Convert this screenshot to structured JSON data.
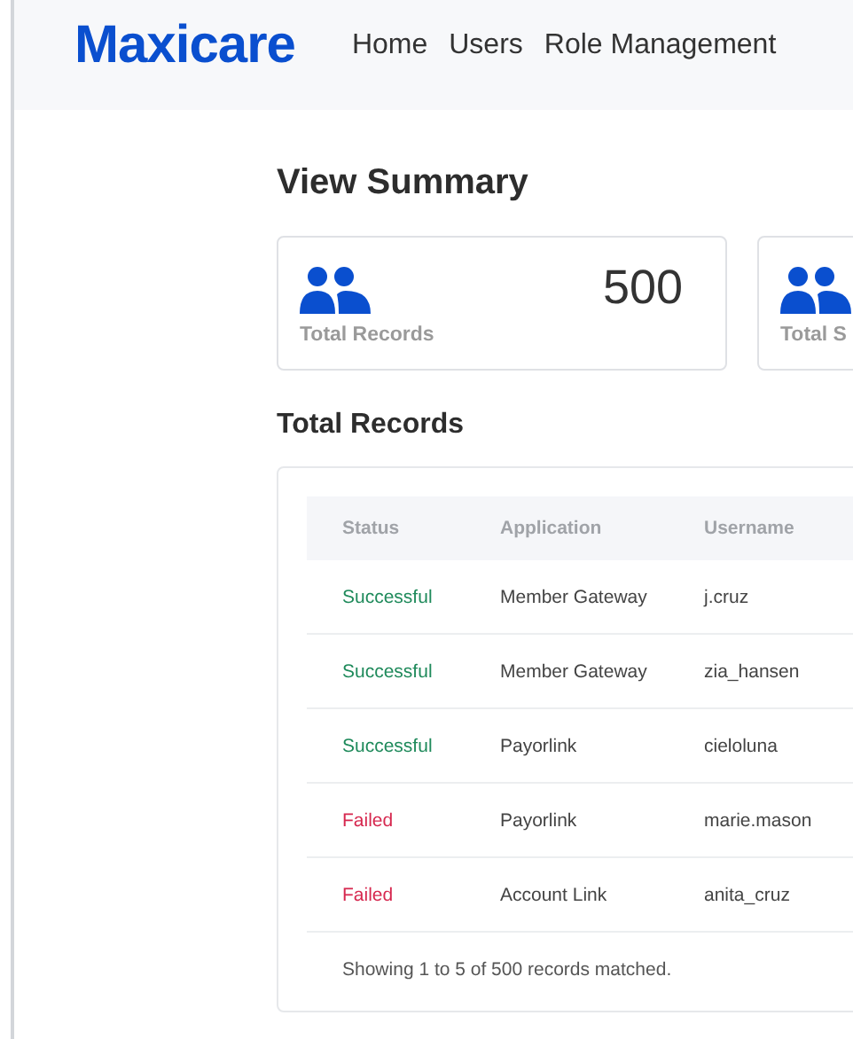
{
  "header": {
    "logo": "Maxicare",
    "nav": [
      {
        "label": "Home"
      },
      {
        "label": "Users"
      },
      {
        "label": "Role Management"
      }
    ]
  },
  "summary": {
    "title": "View Summary",
    "cards": [
      {
        "value": "500",
        "label": "Total Records"
      },
      {
        "label": "Total S"
      }
    ]
  },
  "records": {
    "title": "Total Records",
    "columns": [
      "Status",
      "Application",
      "Username"
    ],
    "rows": [
      {
        "status": "Successful",
        "kind": "success",
        "application": "Member Gateway",
        "username": "j.cruz"
      },
      {
        "status": "Successful",
        "kind": "success",
        "application": "Member Gateway",
        "username": "zia_hansen"
      },
      {
        "status": "Successful",
        "kind": "success",
        "application": "Payorlink",
        "username": "cieloluna"
      },
      {
        "status": "Failed",
        "kind": "failed",
        "application": "Payorlink",
        "username": "marie.mason"
      },
      {
        "status": "Failed",
        "kind": "failed",
        "application": "Account Link",
        "username": "anita_cruz"
      }
    ],
    "footer": "Showing 1 to 5 of 500 records matched."
  }
}
